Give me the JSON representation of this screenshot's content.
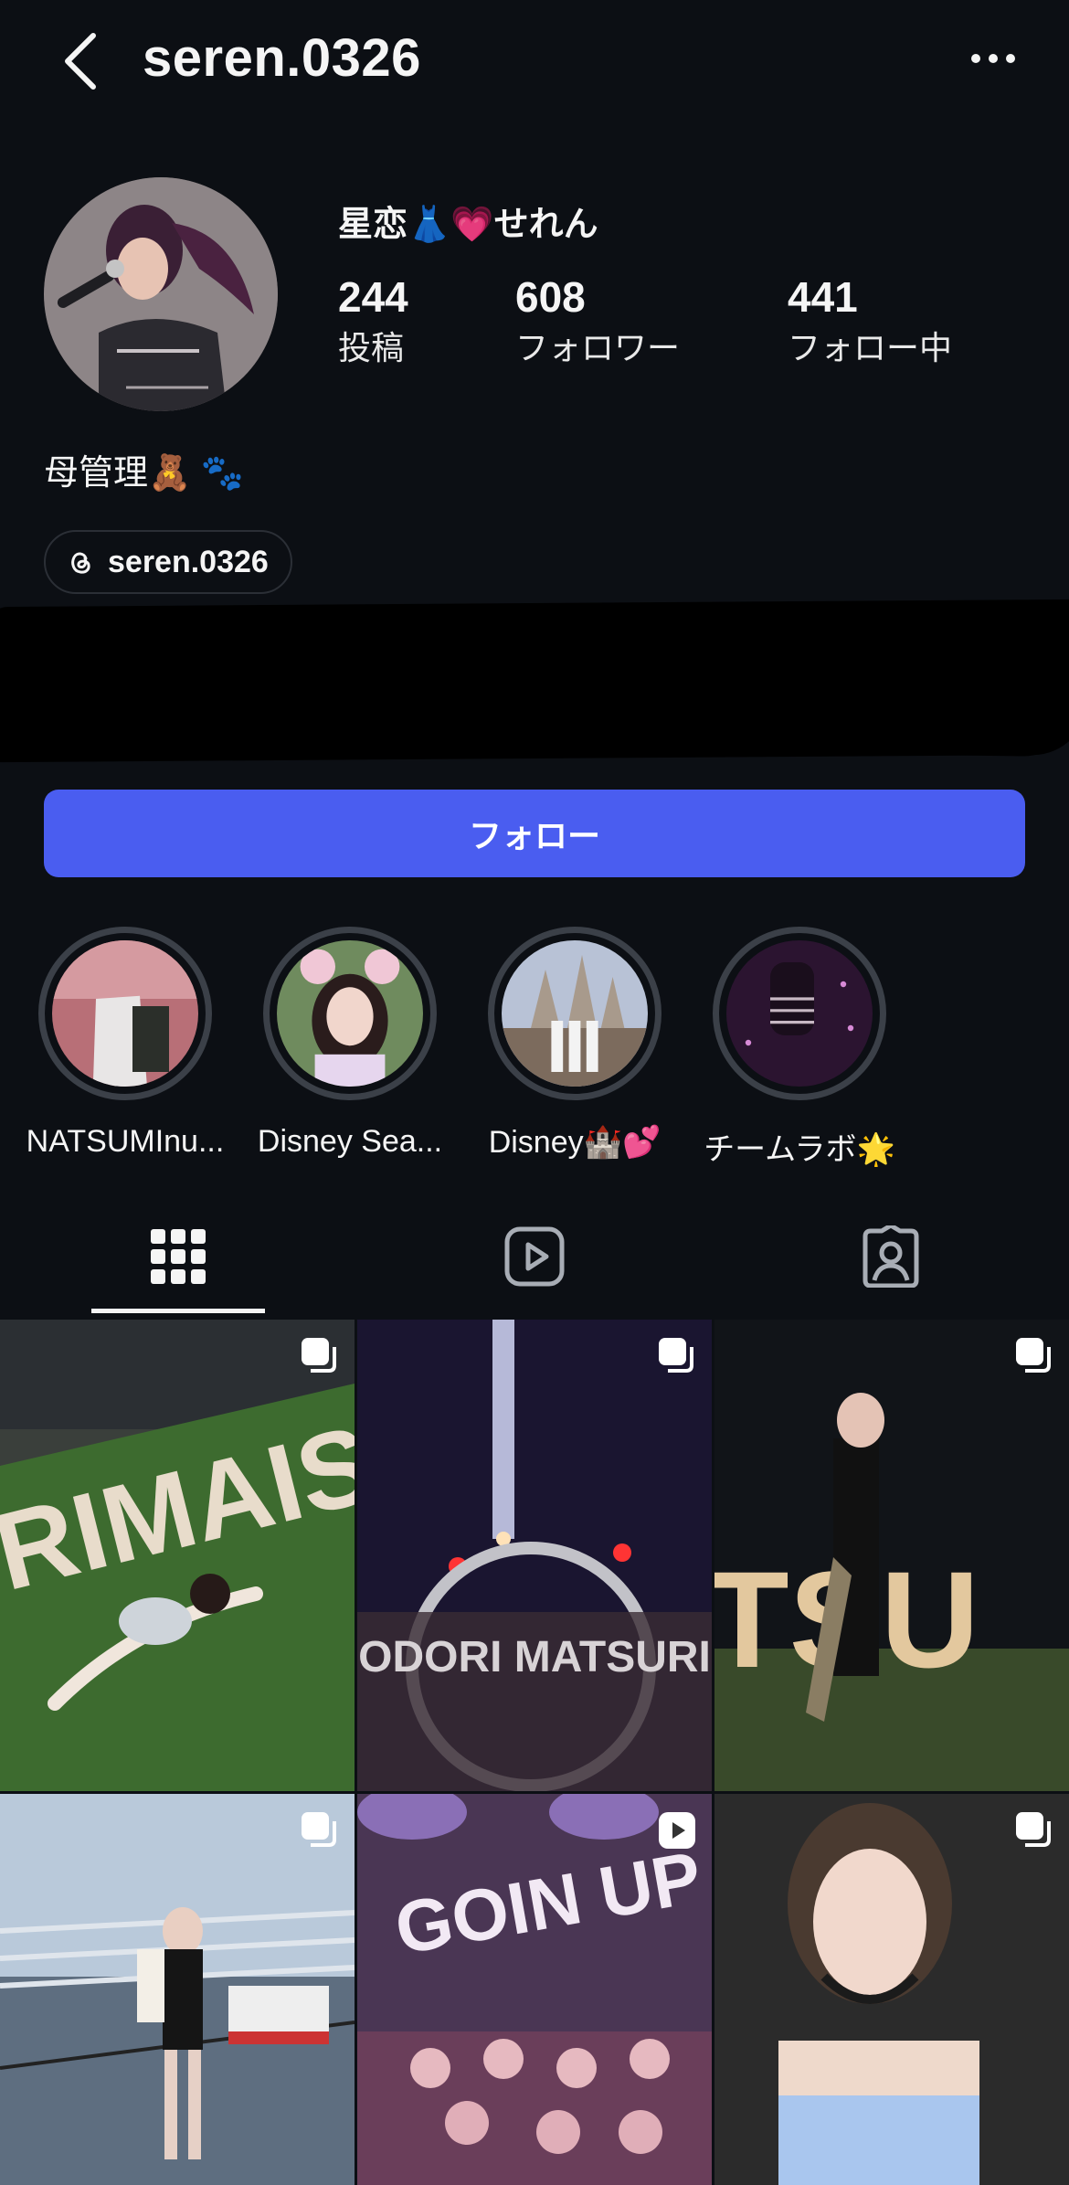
{
  "header": {
    "username": "seren.0326",
    "back_icon": "chevron-left-icon",
    "more_icon": "more-horizontal-icon"
  },
  "profile": {
    "display_name": "星恋👗💗せれん",
    "stats": [
      {
        "value": "244",
        "label": "投稿"
      },
      {
        "value": "608",
        "label": "フォロワー"
      },
      {
        "value": "441",
        "label": "フォロー中"
      }
    ],
    "bio": "母管理🧸 🐾",
    "threads_handle": "seren.0326"
  },
  "follow_button_label": "フォロー",
  "colors": {
    "background": "#0c0f14",
    "accent": "#4a5df0",
    "ring": "#3b4048"
  },
  "highlights": [
    {
      "label": "NATSUMInu..."
    },
    {
      "label": "Disney Sea..."
    },
    {
      "label": "Disney🏰💕"
    },
    {
      "label": "チームラボ🌟"
    }
  ],
  "tabs": [
    {
      "name": "grid",
      "icon": "grid-icon",
      "active": true
    },
    {
      "name": "reels",
      "icon": "reels-icon",
      "active": false
    },
    {
      "name": "tagged",
      "icon": "tagged-user-icon",
      "active": false
    }
  ],
  "posts": [
    {
      "badge": "carousel-icon",
      "overlay_text": "RIMAIS"
    },
    {
      "badge": "carousel-icon",
      "overlay_text": "ODORI MATSURI"
    },
    {
      "badge": "carousel-icon",
      "overlay_text": "TSU"
    },
    {
      "badge": "carousel-icon",
      "overlay_text": ""
    },
    {
      "badge": "reel-play-icon",
      "overlay_text": "GOIN UP"
    },
    {
      "badge": "carousel-icon",
      "overlay_text": ""
    }
  ]
}
